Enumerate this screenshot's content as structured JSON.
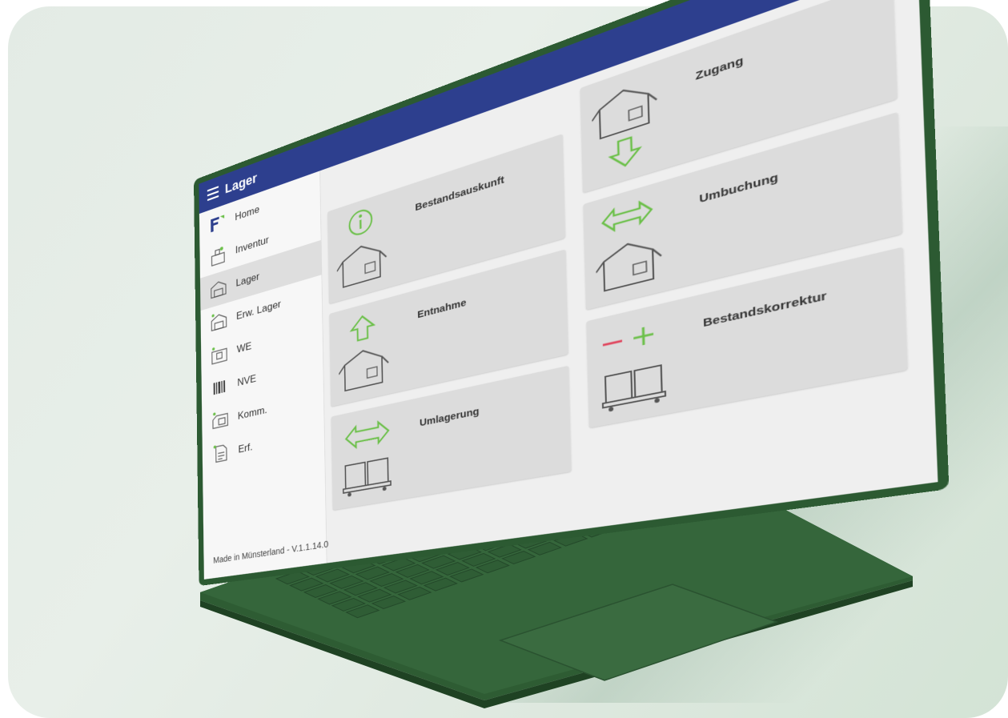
{
  "topbar": {
    "title": "Lager"
  },
  "sidebar": {
    "items": [
      {
        "label": "Home"
      },
      {
        "label": "Inventur"
      },
      {
        "label": "Lager"
      },
      {
        "label": "Erw. Lager"
      },
      {
        "label": "WE"
      },
      {
        "label": "NVE"
      },
      {
        "label": "Komm."
      },
      {
        "label": "Erf."
      }
    ],
    "active_index": 2,
    "footer": "Made in Münsterland - V.1.1.14.0"
  },
  "tiles": [
    {
      "label": "Bestandsauskunft",
      "icon": "info-box-icon"
    },
    {
      "label": "Zugang",
      "icon": "box-arrow-down-icon"
    },
    {
      "label": "Umbuchung",
      "icon": "box-swap-icon"
    },
    {
      "label": "Entnahme",
      "icon": "box-arrow-up-icon"
    },
    {
      "label": "Bestandskorrektur",
      "icon": "plus-minus-pallet-icon"
    },
    {
      "label": "Umlagerung",
      "icon": "swap-pallet-icon"
    }
  ],
  "colors": {
    "topbar": "#2d3f8e",
    "accent_green": "#6cc04a",
    "logout_red": "#e0425a",
    "laptop_body": "#2c5a32"
  }
}
